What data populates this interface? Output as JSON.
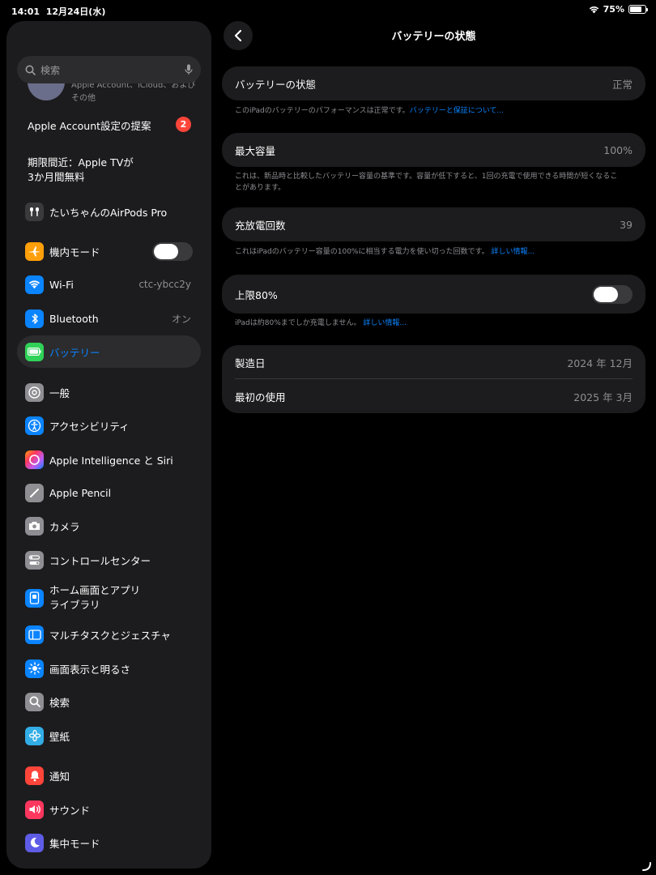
{
  "status": {
    "time": "14:01",
    "date": "12月24日(水)",
    "battery": "75%",
    "battery_level": 0.75
  },
  "sidebar": {
    "search_placeholder": "検索",
    "account_sub": "Apple Account、iCloud、および",
    "account_sub2": "その他",
    "suggestion": "Apple Account設定の提案",
    "suggestion_badge": "2",
    "promo_line1": "期限間近：Apple TVが",
    "promo_line2": "3か月間無料",
    "airpods": "たいちゃんのAirPods Pro",
    "items": [
      {
        "label": "機内モード",
        "icon": "airplane-icon",
        "color": "#ff9f0a"
      },
      {
        "label": "Wi-Fi",
        "value": "ctc-ybcc2y",
        "icon": "wifi-icon",
        "color": "#0a84ff"
      },
      {
        "label": "Bluetooth",
        "value": "オン",
        "icon": "bluetooth-icon",
        "color": "#0a84ff"
      },
      {
        "label": "バッテリー",
        "icon": "battery-icon",
        "color": "#30d158"
      },
      {
        "label": "一般",
        "icon": "gear-icon",
        "color": "#8e8e93"
      },
      {
        "label": "アクセシビリティ",
        "icon": "accessibility-icon",
        "color": "#0a84ff"
      },
      {
        "label": "Apple Intelligence と Siri",
        "icon": "siri-icon",
        "color": "#bf5af2"
      },
      {
        "label": "Apple Pencil",
        "icon": "pencil-icon",
        "color": "#8e8e93"
      },
      {
        "label": "カメラ",
        "icon": "camera-icon",
        "color": "#8e8e93"
      },
      {
        "label": "コントロールセンター",
        "icon": "control-center-icon",
        "color": "#8e8e93"
      },
      {
        "label": "ホーム画面とアプリ",
        "label2": "ライブラリ",
        "icon": "home-screen-icon",
        "color": "#0a84ff"
      },
      {
        "label": "マルチタスクとジェスチャ",
        "icon": "multitask-icon",
        "color": "#0a84ff"
      },
      {
        "label": "画面表示と明るさ",
        "icon": "brightness-icon",
        "color": "#0a84ff"
      },
      {
        "label": "検索",
        "icon": "search-icon",
        "color": "#8e8e93"
      },
      {
        "label": "壁紙",
        "icon": "wallpaper-icon",
        "color": "#32ade6"
      },
      {
        "label": "通知",
        "icon": "notification-icon",
        "color": "#ff453a"
      },
      {
        "label": "サウンド",
        "icon": "sound-icon",
        "color": "#ff375f"
      },
      {
        "label": "集中モード",
        "icon": "focus-icon",
        "color": "#5e5ce6"
      }
    ]
  },
  "detail": {
    "title": "バッテリーの状態",
    "health_label": "バッテリーの状態",
    "health_value": "正常",
    "health_note": "このiPadのバッテリーのパフォーマンスは正常です。",
    "health_link": "バッテリーと保証について...",
    "capacity_label": "最大容量",
    "capacity_value": "100%",
    "capacity_note": "これは、新品時と比較したバッテリー容量の基準です。容量が低下すると、1回の充電で使用できる時間が短くなることがあります。",
    "cycle_label": "充放電回数",
    "cycle_value": "39",
    "cycle_note": "これはiPadのバッテリー容量の100%に相当する電力を使い切った回数です。",
    "cycle_link": "詳しい情報...",
    "limit_label": "上限80%",
    "limit_note": "iPadは約80%までしか充電しません。",
    "limit_link": "詳しい情報...",
    "manufacture_label": "製造日",
    "manufacture_value": "2024 年 12月",
    "first_use_label": "最初の使用",
    "first_use_value": "2025 年 3月"
  }
}
